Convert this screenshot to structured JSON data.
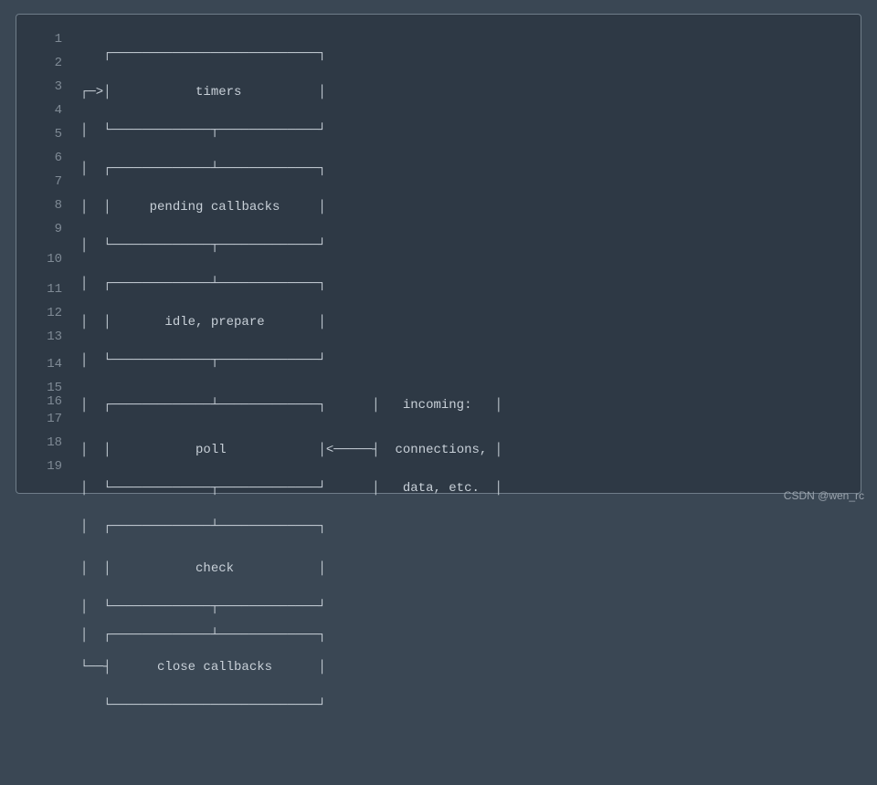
{
  "diagram": {
    "stages": {
      "timers": "timers",
      "pending": "pending callbacks",
      "idle": "idle, prepare",
      "poll": "poll",
      "check": "check",
      "close": "close callbacks"
    },
    "incoming": {
      "label": "incoming:",
      "connections": "connections,",
      "data": "data, etc."
    },
    "line_numbers": [
      "1",
      "2",
      "3",
      "4",
      "5",
      "6",
      "7",
      "8",
      "9",
      "10",
      "11",
      "12",
      "13",
      "14",
      "15",
      "16",
      "17",
      "18",
      "19"
    ]
  },
  "watermark": "CSDN @wen_rc"
}
